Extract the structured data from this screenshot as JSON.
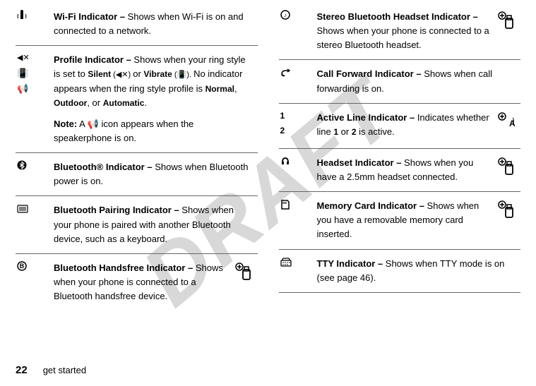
{
  "watermark": "DRAFT",
  "footer": {
    "page": "22",
    "section": "get started"
  },
  "left": [
    {
      "icon": "wifi-icon",
      "glyphs": [
        "📶"
      ],
      "title": "Wi-Fi Indicator –",
      "body": " Shows when Wi-Fi is on and connected to a network."
    },
    {
      "icon": "profile-icon",
      "glyphs": [
        "◀✕",
        "📳",
        "📢"
      ],
      "title": "Profile Indicator –",
      "body": " Shows when your ring style is set to ",
      "extra1": "Silent",
      "extra1g": " (◀✕) ",
      "extra2": "or ",
      "extra3": "Vibrate",
      "extra3g": " (📳). ",
      "extra4": "No indicator appears when the ring style profile is ",
      "extra5": "Normal",
      "extra6": ", ",
      "extra7": "Outdoor",
      "extra8": ", or ",
      "extra9": "Automatic",
      "extra10": ".",
      "noteLabel": "Note:",
      "noteBody": " A 📢 icon appears when the speakerphone is on."
    },
    {
      "icon": "bluetooth-icon",
      "glyphs": [
        "⦿"
      ],
      "title": "Bluetooth® Indicator –",
      "body": " Shows when Bluetooth power is on."
    },
    {
      "icon": "bt-pair-icon",
      "glyphs": [
        "⌨"
      ],
      "title": "Bluetooth Pairing Indicator –",
      "body": " Shows when your phone is paired with another Bluetooth device, such as a keyboard."
    },
    {
      "icon": "bt-handsfree-icon",
      "glyphs": [
        "⊕"
      ],
      "title": "Bluetooth Handsfree Indicator –",
      "body": " Shows when your phone is connected to a Bluetooth handsfree device.",
      "badge": true
    }
  ],
  "right": [
    {
      "icon": "bt-stereo-icon",
      "glyphs": [
        "🎧"
      ],
      "title": "Stereo Bluetooth Headset Indicator –",
      "body": " Shows when your phone is connected to a stereo Bluetooth headset.",
      "badge": true
    },
    {
      "icon": "call-fwd-icon",
      "glyphs": [
        "↪"
      ],
      "title": "Call Forward Indicator –",
      "body": " Shows when call forwarding is on."
    },
    {
      "icon": "active-line-icon",
      "glyphs": [
        "1",
        "2"
      ],
      "title": "Active Line Indicator –",
      "body": " Indicates whether line ",
      "extra1": "1",
      "extra2": " or ",
      "extra3": "2",
      "extra4": " is active.",
      "badge": true
    },
    {
      "icon": "headset-icon",
      "glyphs": [
        "🎧"
      ],
      "title": "Headset Indicator –",
      "body": " Shows when you have a 2.5mm headset connected.",
      "badge": true
    },
    {
      "icon": "memcard-icon",
      "glyphs": [
        "💾"
      ],
      "title": "Memory Card Indicator –",
      "body": " Shows when you have a removable memory card inserted.",
      "badge": true
    },
    {
      "icon": "tty-icon",
      "glyphs": [
        "⌨"
      ],
      "title": "TTY Indicator –",
      "body": " Shows when TTY mode is on (see page 46)."
    }
  ]
}
